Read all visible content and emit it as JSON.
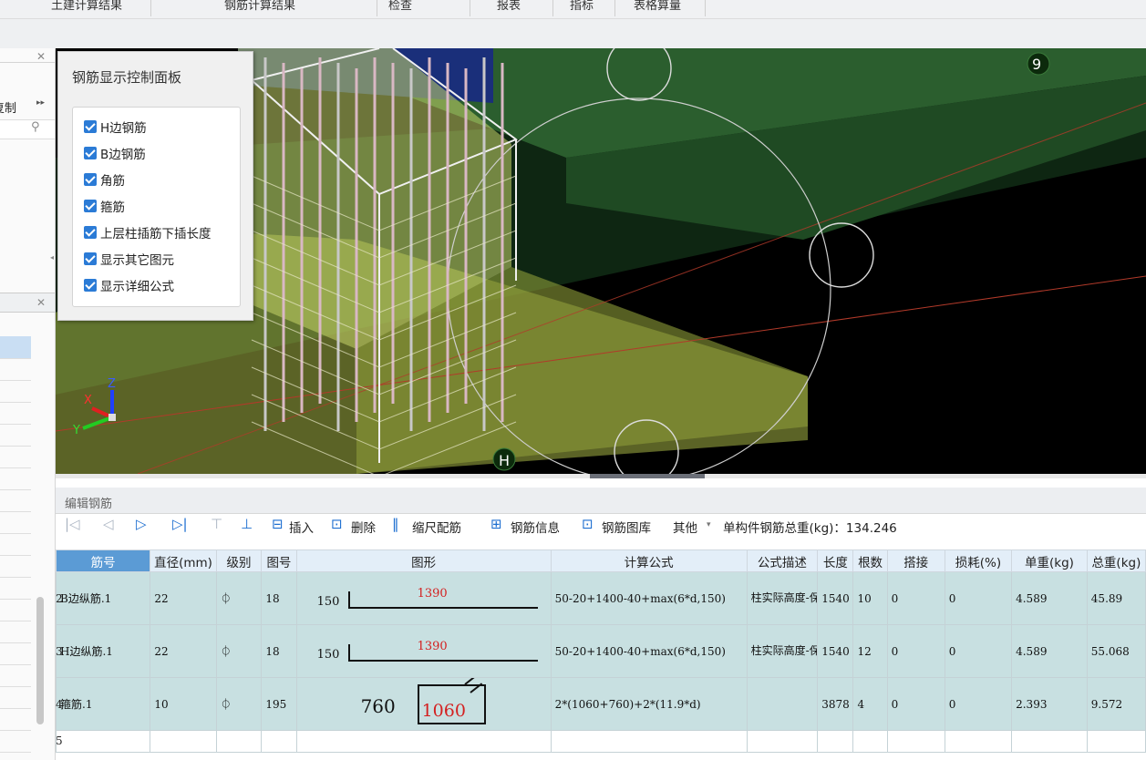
{
  "menu_tabs": [
    "土建计算结果",
    "钢筋计算结果",
    "检查",
    "报表",
    "指标",
    "表格算量"
  ],
  "left_panel": {
    "copy_label": "复制",
    "more_icon": "double-chevron-icon",
    "search_icon": "search-icon"
  },
  "viewport": {
    "axis_label_9": "9",
    "axis_label_h": "H",
    "gizmo": {
      "x": "X",
      "y": "Y",
      "z": "Z"
    }
  },
  "control_panel": {
    "title": "钢筋显示控制面板",
    "options": [
      {
        "label": "H边钢筋",
        "checked": true
      },
      {
        "label": "B边钢筋",
        "checked": true
      },
      {
        "label": "角筋",
        "checked": true
      },
      {
        "label": "箍筋",
        "checked": true
      },
      {
        "label": "上层柱插筋下插长度",
        "checked": true
      },
      {
        "label": "显示其它图元",
        "checked": true
      },
      {
        "label": "显示详细公式",
        "checked": true
      }
    ]
  },
  "editor": {
    "title": "编辑钢筋",
    "toolbar": {
      "insert": "插入",
      "delete": "删除",
      "scale": "缩尺配筋",
      "info": "钢筋信息",
      "library": "钢筋图库",
      "other": "其他",
      "total_label": "单构件钢筋总重(kg)：134.246"
    },
    "columns": [
      "筋号",
      "直径(mm)",
      "级别",
      "图号",
      "图形",
      "计算公式",
      "公式描述",
      "长度",
      "根数",
      "搭接",
      "损耗(%)",
      "单重(kg)",
      "总重(kg)"
    ],
    "rows": [
      {
        "num": "2",
        "name": "B边纵筋.1",
        "dia": "22",
        "grade": "⏀",
        "fig": "18",
        "shape_left": "150",
        "shape_top": "1390",
        "formula": "50-20+1400-40+max(6*d,150)",
        "desc": "柱实际高度-保…",
        "len": "1540",
        "count": "10",
        "lap": "0",
        "loss": "0",
        "unit": "4.589",
        "total": "45.89"
      },
      {
        "num": "3",
        "name": "H边纵筋.1",
        "dia": "22",
        "grade": "⏀",
        "fig": "18",
        "shape_left": "150",
        "shape_top": "1390",
        "formula": "50-20+1400-40+max(6*d,150)",
        "desc": "柱实际高度-保…",
        "len": "1540",
        "count": "12",
        "lap": "0",
        "loss": "0",
        "unit": "4.589",
        "total": "55.068"
      },
      {
        "num": "4",
        "name": "箍筋.1",
        "dia": "10",
        "grade": "⏀",
        "fig": "195",
        "shape_left": "760",
        "shape_top": "1060",
        "formula": "2*(1060+760)+2*(11.9*d)",
        "desc": "",
        "len": "3878",
        "count": "4",
        "lap": "0",
        "loss": "0",
        "unit": "2.393",
        "total": "9.572"
      }
    ],
    "empty_row_num": "5"
  },
  "colors": {
    "accent": "#5b9bd5",
    "row_bg": "#c8e0e1",
    "shape_red": "#d42020"
  }
}
